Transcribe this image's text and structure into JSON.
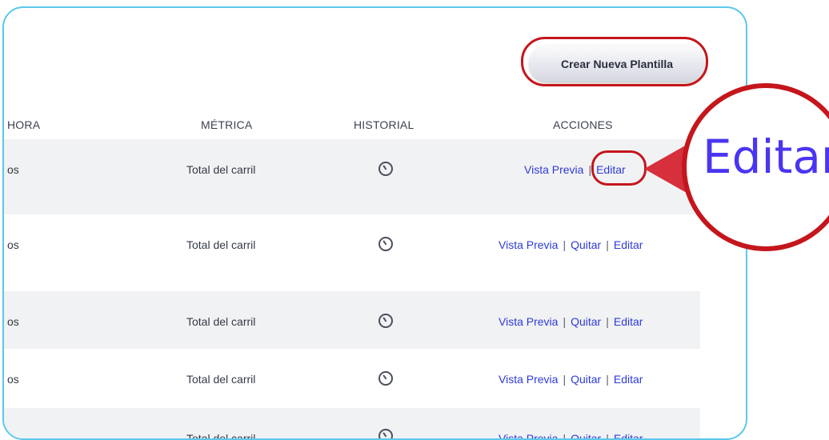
{
  "toolbar": {
    "create_label": "Crear Nueva Plantilla"
  },
  "table": {
    "headers": {
      "hora": "HORA",
      "metrica": "MÉTRICA",
      "historial": "HISTORIAL",
      "acciones": "ACCIONES"
    },
    "rows": [
      {
        "hora": "os",
        "metrica": "Total del carril",
        "preview": "Vista Previa",
        "remove": "",
        "edit": "Editar"
      },
      {
        "hora": "os",
        "metrica": "Total del carril",
        "preview": "Vista Previa",
        "remove": "Quitar",
        "edit": "Editar"
      },
      {
        "hora": "os",
        "metrica": "Total del carril",
        "preview": "Vista Previa",
        "remove": "Quitar",
        "edit": "Editar"
      },
      {
        "hora": "os",
        "metrica": "Total del carril",
        "preview": "Vista Previa",
        "remove": "Quitar",
        "edit": "Editar"
      },
      {
        "hora": "",
        "metrica": "Total del carril",
        "preview": "Vista Previa",
        "remove": "Quitar",
        "edit": "Editar"
      }
    ],
    "separator": "|"
  },
  "callout": {
    "zoom_text": "Editar"
  },
  "colors": {
    "panel_border": "#5bc8ec",
    "highlight": "#c4161c",
    "link": "#2e3bd6",
    "row_shade": "#f1f2f4"
  },
  "icons": {
    "history": "clock-icon"
  }
}
